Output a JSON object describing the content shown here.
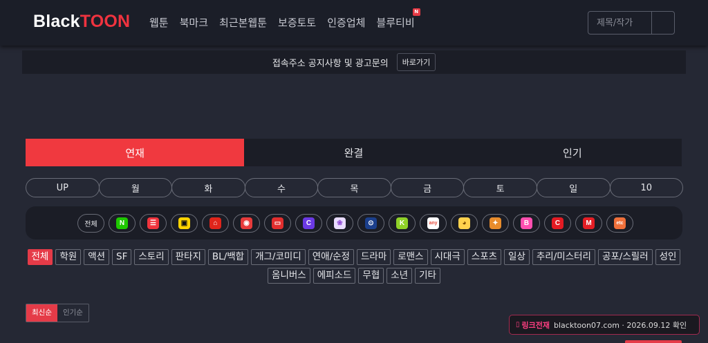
{
  "header": {
    "logo_part1": "Black",
    "logo_part2": "TOON",
    "nav": [
      {
        "label": "웹툰"
      },
      {
        "label": "북마크"
      },
      {
        "label": "최근본웹툰"
      },
      {
        "label": "보증토토"
      },
      {
        "label": "인증업체"
      },
      {
        "label": "블루티비",
        "badge": "N"
      }
    ],
    "search_placeholder": "제목/작가"
  },
  "notice": {
    "text": "접속주소 공지사항 및 광고문의",
    "button": "바로가기"
  },
  "main_tabs": [
    "연재",
    "완결",
    "인기"
  ],
  "active_main_tab": "연재",
  "day_tabs": [
    "UP",
    "월",
    "화",
    "수",
    "목",
    "금",
    "토",
    "일",
    "10"
  ],
  "platforms": {
    "all_label": "전체",
    "items": [
      {
        "name": "naver",
        "glyph": "N",
        "bg": "#1ec800",
        "fg": "#ffffff"
      },
      {
        "name": "kakaopage",
        "glyph": "☰",
        "bg": "#f0343d",
        "fg": "#ffffff"
      },
      {
        "name": "kakao",
        "glyph": "▣",
        "bg": "#ffd400",
        "fg": "#111111"
      },
      {
        "name": "toptoon",
        "glyph": "⌂",
        "bg": "#e0251b",
        "fg": "#ffffff"
      },
      {
        "name": "lezhin",
        "glyph": "◉",
        "bg": "#e73b3b",
        "fg": "#ffffff"
      },
      {
        "name": "toomics",
        "glyph": "▭",
        "bg": "#e22e2e",
        "fg": "#ffffff"
      },
      {
        "name": "comico",
        "glyph": "C",
        "bg": "#6b39e4",
        "fg": "#ffffff"
      },
      {
        "name": "bomtoon",
        "glyph": "❀",
        "bg": "#e9dcff",
        "fg": "#8f4ad6"
      },
      {
        "name": "mrblue",
        "glyph": "⊙",
        "bg": "#1b3f8c",
        "fg": "#ffffff"
      },
      {
        "name": "kbook",
        "glyph": "K",
        "bg": "#8fd128",
        "fg": "#ffffff"
      },
      {
        "name": "anytoon",
        "glyph": "any",
        "bg": "#ffffff",
        "fg": "#e84c3d"
      },
      {
        "name": "duck",
        "glyph": "◕",
        "bg": "#ffd24d",
        "fg": "#7a4a00"
      },
      {
        "name": "fox",
        "glyph": "✦",
        "bg": "#e88c2c",
        "fg": "#ffffff"
      },
      {
        "name": "bookcube",
        "glyph": "B",
        "bg": "#ff4fb0",
        "fg": "#ffffff"
      },
      {
        "name": "ctoon",
        "glyph": "C",
        "bg": "#e31b23",
        "fg": "#ffffff"
      },
      {
        "name": "mtoon",
        "glyph": "M",
        "bg": "#e51e25",
        "fg": "#ffffff"
      },
      {
        "name": "etc",
        "glyph": "etc",
        "bg": "#f0703a",
        "fg": "#ffffff"
      }
    ]
  },
  "genres": [
    "전체",
    "학원",
    "액션",
    "SF",
    "스토리",
    "판타지",
    "BL/백합",
    "개그/코미디",
    "연애/순정",
    "드라마",
    "로맨스",
    "시대극",
    "스포츠",
    "일상",
    "추리/미스터리",
    "공포/스릴러",
    "성인",
    "옴니버스",
    "에피소드",
    "무협",
    "소년",
    "기타"
  ],
  "active_genre": "전체",
  "sort": [
    "최신순",
    "인기순"
  ],
  "active_sort": "최신순",
  "link_toast": {
    "icon": "lock-icon",
    "label": "링크전재",
    "text": "blacktoon07.com · 2026.09.12 확인"
  },
  "colors": {
    "accent": "#f0393f",
    "background": "#252834",
    "panel": "#1b1d26"
  }
}
